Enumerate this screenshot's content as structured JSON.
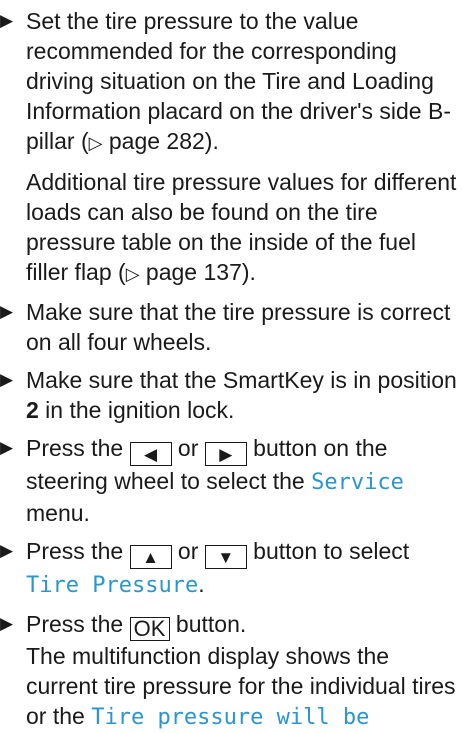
{
  "steps": [
    {
      "line": "Set the tire pressure to the value recommended for the corresponding driving situation on the Tire and Loading Information placard on the driver's side B-pillar (",
      "ref_symbol": "▷",
      "ref": " page 282",
      "end": ").",
      "sub_line": "Additional tire pressure values for different loads can also be found on the tire pressure table on the inside of the fuel filler flap (",
      "sub_ref": " page 137",
      "sub_end": ")."
    },
    {
      "line": "Make sure that the tire pressure is correct on all four wheels."
    },
    {
      "line_a": "Make sure that the SmartKey is in position ",
      "bold": "2",
      "line_b": " in the ignition lock."
    },
    {
      "pre": "Press the ",
      "key1": "◀",
      "mid": " or ",
      "key2": "▶",
      "post": " button on the steering wheel to select the ",
      "display": "Service",
      "end": " menu."
    },
    {
      "pre": "Press the ",
      "key1": "▲",
      "mid": " or ",
      "key2": "▼",
      "post": " button to select ",
      "display": "Tire Pressure",
      "end": "."
    },
    {
      "pre": "Press the ",
      "key": "OK",
      "post": " button.",
      "result": "The multifunction display shows the current tire pressure for the individual tires or the ",
      "display": "Tire pressure will be"
    }
  ],
  "bullet_symbol": "▶"
}
